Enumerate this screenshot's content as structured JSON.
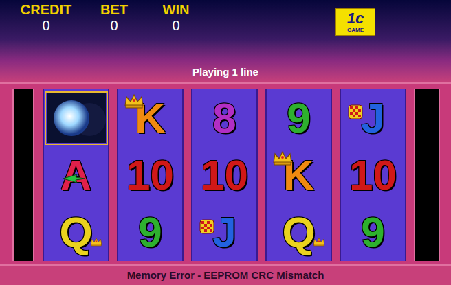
{
  "meters": [
    {
      "label": "CREDIT",
      "value": "0"
    },
    {
      "label": "BET",
      "value": "0"
    },
    {
      "label": "WIN",
      "value": "0"
    }
  ],
  "logo": {
    "main": "1c",
    "sub": "GAME"
  },
  "message": "Playing 1 line",
  "reels": [
    [
      {
        "label": "",
        "kind": "moon",
        "color": "#9fd8ff",
        "highlighted": true
      },
      {
        "label": "A",
        "kind": "arrow",
        "color": "#e0204a",
        "highlighted": false
      },
      {
        "label": "Q",
        "kind": "crown-small",
        "color": "#ead21e",
        "highlighted": false
      }
    ],
    [
      {
        "label": "K",
        "kind": "crown",
        "color": "#f08a10",
        "highlighted": false
      },
      {
        "label": "10",
        "kind": "plain",
        "color": "#d01818",
        "highlighted": false
      },
      {
        "label": "9",
        "kind": "plain",
        "color": "#2eb02e",
        "highlighted": false
      }
    ],
    [
      {
        "label": "8",
        "kind": "plain",
        "color": "#b22ec4",
        "highlighted": false
      },
      {
        "label": "10",
        "kind": "plain",
        "color": "#d01818",
        "highlighted": false
      },
      {
        "label": "J",
        "kind": "chip",
        "color": "#2262e0",
        "highlighted": false
      }
    ],
    [
      {
        "label": "9",
        "kind": "plain",
        "color": "#2eb02e",
        "highlighted": false
      },
      {
        "label": "K",
        "kind": "crown",
        "color": "#f08a10",
        "highlighted": false
      },
      {
        "label": "Q",
        "kind": "crown-small",
        "color": "#ead21e",
        "highlighted": false
      }
    ],
    [
      {
        "label": "J",
        "kind": "chip",
        "color": "#2262e0",
        "highlighted": false
      },
      {
        "label": "10",
        "kind": "plain",
        "color": "#d01818",
        "highlighted": false
      },
      {
        "label": "9",
        "kind": "plain",
        "color": "#2eb02e",
        "highlighted": false
      }
    ]
  ],
  "status_bar": "Memory Error - EEPROM CRC Mismatch"
}
